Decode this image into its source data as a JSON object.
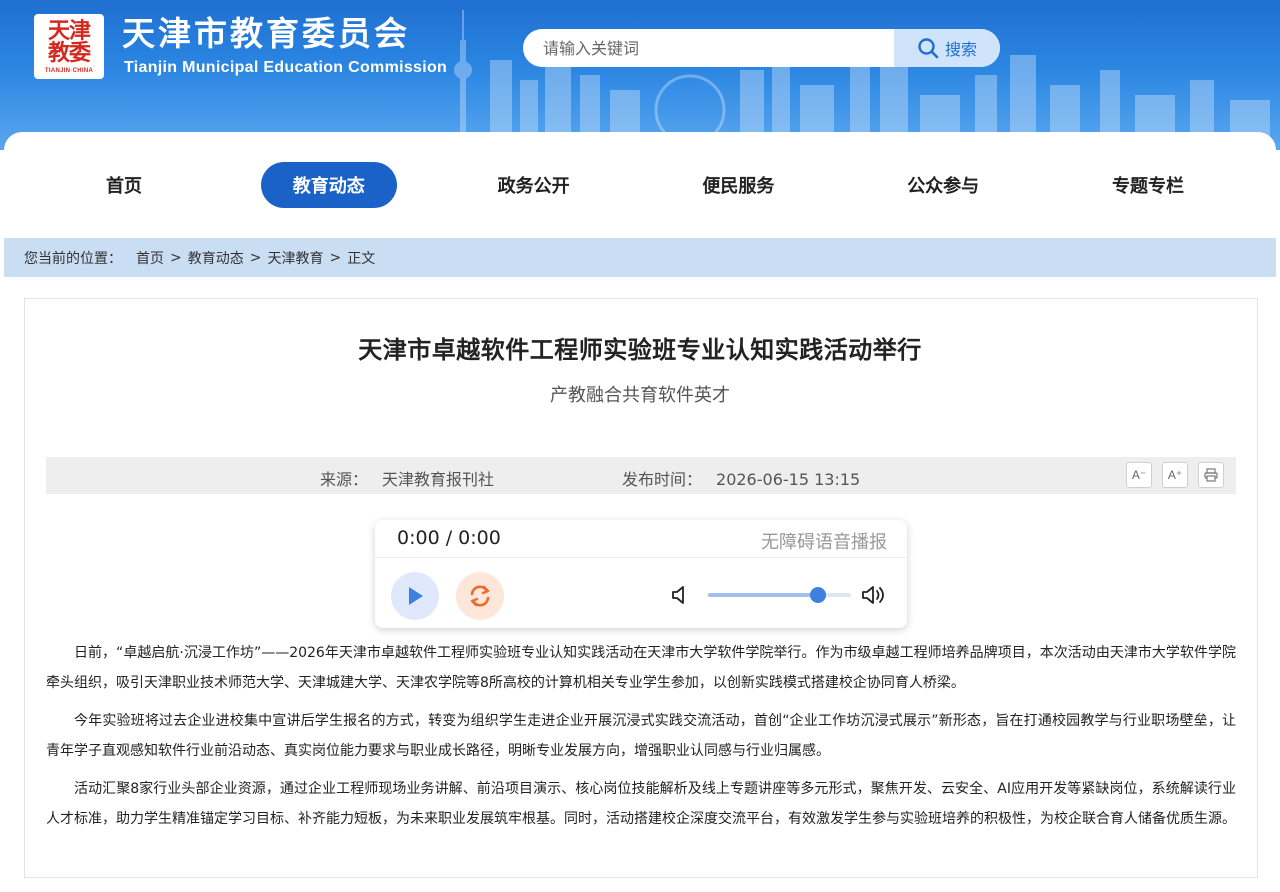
{
  "header": {
    "logo_mark_top": "天津",
    "logo_mark_bottom": "教委",
    "logo_sub": "TIANJIN·CHINA",
    "title": "天津市教育委员会",
    "title_en": "Tianjin Municipal Education Commission",
    "brand_color": "#1f6fd0"
  },
  "search": {
    "placeholder": "请输入关键词",
    "button_label": "搜索",
    "icon": "search-icon"
  },
  "nav": {
    "items": [
      {
        "label": "首页",
        "active": false
      },
      {
        "label": "教育动态",
        "active": true
      },
      {
        "label": "政务公开",
        "active": false
      },
      {
        "label": "便民服务",
        "active": false
      },
      {
        "label": "公众参与",
        "active": false
      },
      {
        "label": "专题专栏",
        "active": false
      }
    ],
    "active_color": "#1a62c8"
  },
  "breadcrumb": {
    "prefix": "您当前的位置：",
    "items": [
      "首页",
      "教育动态",
      "天津教育",
      "正文"
    ],
    "separator": ">"
  },
  "article": {
    "title": "天津市卓越软件工程师实验班专业认知实践活动举行",
    "subtitle": "产教融合共育软件英才",
    "source_label": "来源：",
    "source": "天津教育报刊社",
    "time_label": "发布时间：",
    "time": "2026-06-15 13:15",
    "tools": {
      "decrease_font": "A⁻",
      "increase_font": "A⁺",
      "print_icon": "print-icon"
    },
    "paragraphs": [
      "日前，“卓越启航·沉浸工作坊”——2026年天津市卓越软件工程师实验班专业认知实践活动在天津市大学软件学院举行。作为市级卓越工程师培养品牌项目，本次活动由天津市大学软件学院牵头组织，吸引天津职业技术师范大学、天津城建大学、天津农学院等8所高校的计算机相关专业学生参加，以创新实践模式搭建校企协同育人桥梁。",
      "今年实验班将过去企业进校集中宣讲后学生报名的方式，转变为组织学生走进企业开展沉浸式实践交流活动，首创“企业工作坊沉浸式展示”新形态，旨在打通校园教学与行业职场壁垒，让青年学子直观感知软件行业前沿动态、真实岗位能力要求与职业成长路径，明晰专业发展方向，增强职业认同感与行业归属感。",
      "活动汇聚8家行业头部企业资源，通过企业工程师现场业务讲解、前沿项目演示、核心岗位技能解析及线上专题讲座等多元形式，聚焦开发、云安全、AI应用开发等紧缺岗位，系统解读行业人才标准，助力学生精准锚定学习目标、补齐能力短板，为未来职业发展筑牢根基。同时，活动搭建校企深度交流平台，有效激发学生参与实验班培养的积极性，为校企联合育人储备优质生源。"
    ]
  },
  "player": {
    "time_display": "0:00 / 0:00",
    "label": "无障碍语音播报",
    "volume_fraction": 0.77,
    "play_icon": "play-icon",
    "repeat_icon": "repeat-icon",
    "volume_low_icon": "volume-low-icon",
    "volume_high_icon": "volume-high-icon"
  }
}
